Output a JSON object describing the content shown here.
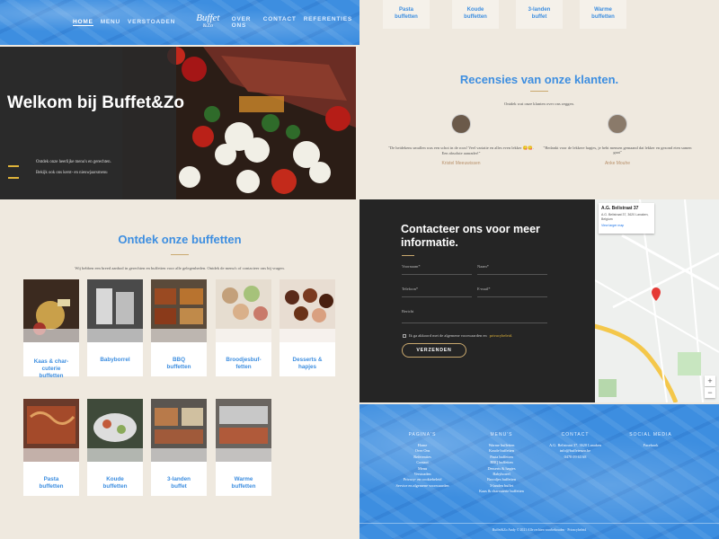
{
  "nav": {
    "left_items": [
      "Home",
      "Menu",
      "Verstoaden"
    ],
    "logo_main": "Buffet",
    "logo_sub": "&Zo",
    "right_items": [
      "Over ons",
      "Contact",
      "Referenties"
    ]
  },
  "hero": {
    "title": "Welkom bij Buffet&Zo",
    "line1": "Ontdek onze heerlijke menu's en gerechten.",
    "line2": "Bekijk ook ons kerst- en nieuwjaarsmenu"
  },
  "discover": {
    "title": "Ontdek onze buffetten",
    "description": "Wij hebben een breed aanbod in gerechten en buffetten voor alle gelegenheden. Ontdek de menu's of contacteer ons bij vragen.",
    "cards_row1": [
      "Kaas & char-\ncuterie\nbuffetten",
      "Babyborrel",
      "BBQ\nbuffetten",
      "Broodjesbuf-\nfetten",
      "Desserts &\nhapjes"
    ],
    "cards_row2": [
      "Pasta\nbuffetten",
      "Koude\nbuffetten",
      "3-landen\nbuffet",
      "Warme\nbuffetten"
    ]
  },
  "top_tabs": [
    "Pasta\nbuffetten",
    "Koude\nbuffetten",
    "3-landen\nbuffet",
    "Warme\nbuffetten"
  ],
  "reviews": {
    "title": "Recensies van onze klanten.",
    "subtitle": "Ontdek wat onze klanten over ons zeggen.",
    "items": [
      {
        "quote": "\"De heidekens smullen was een schot in de roos! Veel variatie en alles even lekker 😋😋. Een absolute aanrader!\"",
        "name": "Kristel Meeuwissen"
      },
      {
        "quote": "\"Bedankt voor de lekkere hapjes, je hebt mensen gemaand dat lekker en gezond eten samen gaat\"",
        "name": "Anke Mouhe"
      }
    ]
  },
  "contact": {
    "title": "Contacteer ons voor meer informatie.",
    "first_name": "Voornaam*",
    "last_name": "Naam*",
    "phone": "Telefoon*",
    "email": "E-mail*",
    "message": "Bericht",
    "consent_text": "Ik ga akkoord met de algemene voorwaarden en",
    "consent_link": "privacybeleid.",
    "send": "VERZENDEN"
  },
  "map": {
    "place": "A.G. Belistraat 37",
    "address": "A.G. Belistraat 37, 3620 Lanaken, Belgium",
    "link": "View larger map",
    "zoom_in": "+",
    "zoom_out": "−"
  },
  "footer": {
    "pages": {
      "head": "PAGINA'S",
      "links": [
        "Home",
        "Over Ons",
        "Referenties",
        "Contact",
        "Menu",
        "Verstoaden",
        "Privacy- en cookiebeleid",
        "Service en algemene voorwaarden"
      ]
    },
    "menus": {
      "head": "MENU'S",
      "links": [
        "Warme buffetten",
        "Koude buffetten",
        "Pasta buffetten",
        "BBQ buffetten",
        "Desserts & hapjes",
        "Babyborrel",
        "Broodjes buffetten",
        "3-landen buffet",
        "Kaas & charcuterie buffetten"
      ]
    },
    "contact": {
      "head": "CONTACT",
      "links": [
        "A.G. Belistraat 37, 3620 Lanaken",
        "info@buffetenzo.be",
        "0478 09 63 68"
      ]
    },
    "social": {
      "head": "SOCIAL MEDIA",
      "links": [
        "Facebook"
      ]
    },
    "copyright": "Buffet&Zo Andy © 2021 Alle rechten voorbehouden · Privacybeleid"
  },
  "colors": {
    "accent": "#3d8ee0",
    "gold": "#c9a96e",
    "dark": "#252525",
    "cream": "#efe9df"
  }
}
